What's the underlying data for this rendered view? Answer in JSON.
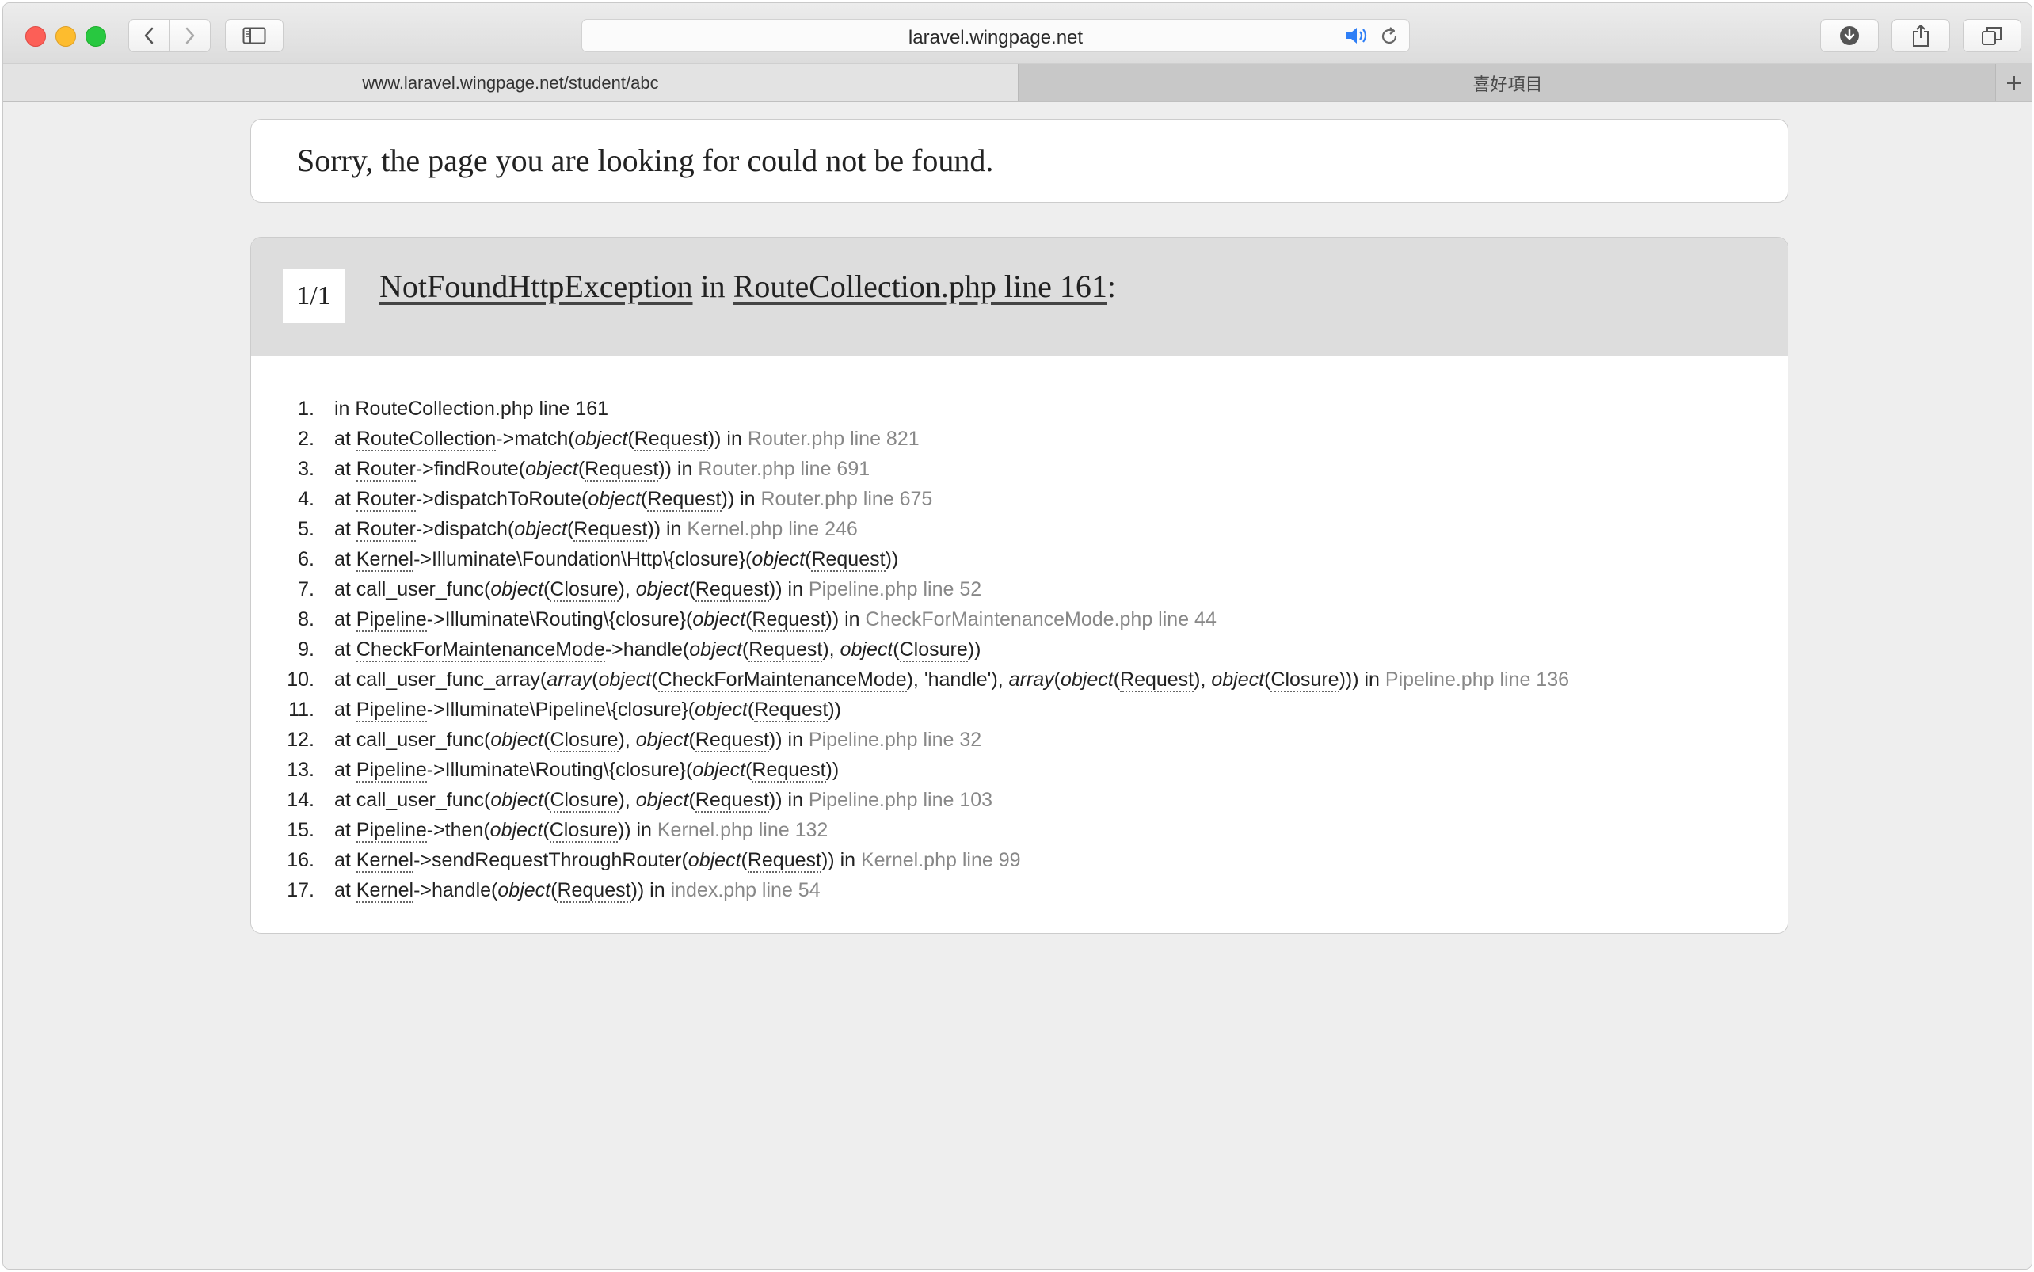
{
  "browser": {
    "address": "laravel.wingpage.net",
    "tabs": [
      {
        "title": "www.laravel.wingpage.net/student/abc",
        "active": true
      },
      {
        "title": "喜好項目",
        "active": false
      }
    ]
  },
  "page": {
    "not_found_message": "Sorry, the page you are looking for could not be found.",
    "exception": {
      "count": "1/1",
      "class_name": "NotFoundHttpException",
      "in_word": "in",
      "location": "RouteCollection.php line 161",
      "colon": ":"
    }
  },
  "trace": [
    {
      "num": "1.",
      "text": "in RouteCollection.php line 161"
    },
    {
      "num": "2.",
      "text": "at RouteCollection->match(object(Request)) in Router.php line 821"
    },
    {
      "num": "3.",
      "text": "at Router->findRoute(object(Request)) in Router.php line 691"
    },
    {
      "num": "4.",
      "text": "at Router->dispatchToRoute(object(Request)) in Router.php line 675"
    },
    {
      "num": "5.",
      "text": "at Router->dispatch(object(Request)) in Kernel.php line 246"
    },
    {
      "num": "6.",
      "text": "at Kernel->Illuminate\\Foundation\\Http\\{closure}(object(Request))"
    },
    {
      "num": "7.",
      "text": "at call_user_func(object(Closure), object(Request)) in Pipeline.php line 52"
    },
    {
      "num": "8.",
      "text": "at Pipeline->Illuminate\\Routing\\{closure}(object(Request)) in CheckForMaintenanceMode.php line 44"
    },
    {
      "num": "9.",
      "text": "at CheckForMaintenanceMode->handle(object(Request), object(Closure))"
    },
    {
      "num": "10.",
      "text": "at call_user_func_array(array(object(CheckForMaintenanceMode), 'handle'), array(object(Request), object(Closure))) in Pipeline.php line 136"
    },
    {
      "num": "11.",
      "text": "at Pipeline->Illuminate\\Pipeline\\{closure}(object(Request))"
    },
    {
      "num": "12.",
      "text": "at call_user_func(object(Closure), object(Request)) in Pipeline.php line 32"
    },
    {
      "num": "13.",
      "text": "at Pipeline->Illuminate\\Routing\\{closure}(object(Request))"
    },
    {
      "num": "14.",
      "text": "at call_user_func(object(Closure), object(Request)) in Pipeline.php line 103"
    },
    {
      "num": "15.",
      "text": "at Pipeline->then(object(Closure)) in Kernel.php line 132"
    },
    {
      "num": "16.",
      "text": "at Kernel->sendRequestThroughRouter(object(Request)) in Kernel.php line 99"
    },
    {
      "num": "17.",
      "text": "at Kernel->handle(object(Request)) in index.php line 54"
    }
  ],
  "colors": {
    "location_gray": "#888888",
    "header_bg": "#dddddd",
    "page_bg": "#eeeeee"
  },
  "icons": [
    "back-icon",
    "forward-icon",
    "sidebar-icon",
    "speaker-icon",
    "reload-icon",
    "download-icon",
    "share-icon",
    "tabs-overview-icon",
    "new-tab-icon"
  ]
}
